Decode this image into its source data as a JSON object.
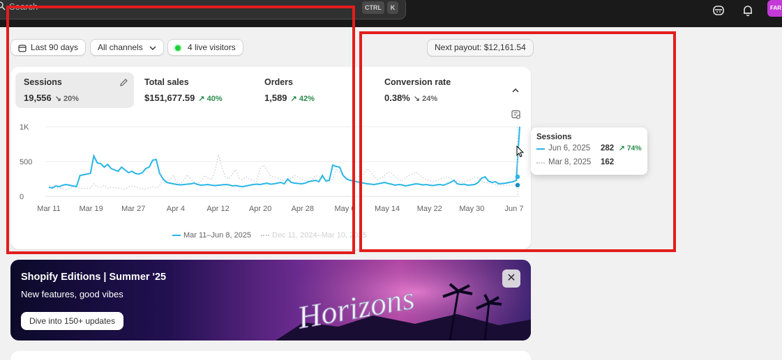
{
  "topbar": {
    "search_placeholder": "Search",
    "shortcut_ctrl": "CTRL",
    "shortcut_k": "K",
    "avatar_initials": "FAR"
  },
  "filters": {
    "date_range": "Last 90 days",
    "channels": "All channels",
    "live_visitors": "4 live visitors",
    "next_payout": "Next payout: $12,161.54"
  },
  "metrics": [
    {
      "label": "Sessions",
      "value": "19,556",
      "change": "20%",
      "direction": "down"
    },
    {
      "label": "Total sales",
      "value": "$151,677.59",
      "change": "40%",
      "direction": "up"
    },
    {
      "label": "Orders",
      "value": "1,589",
      "change": "42%",
      "direction": "up"
    },
    {
      "label": "Conversion rate",
      "value": "0.38%",
      "change": "24%",
      "direction": "down"
    }
  ],
  "chart_data": {
    "type": "line",
    "y_ticks": [
      "1K",
      "500",
      "0"
    ],
    "ylim": [
      0,
      1000
    ],
    "x_ticks": [
      "Mar 11",
      "Mar 19",
      "Mar 27",
      "Apr 4",
      "Apr 12",
      "Apr 20",
      "Apr 28",
      "May 6",
      "May 14",
      "May 22",
      "May 30",
      "Jun 7"
    ],
    "series": [
      {
        "name": "Mar 11–Jun 8, 2025",
        "color": "#29b6e6",
        "style": "solid",
        "values": [
          130,
          120,
          150,
          140,
          160,
          170,
          160,
          150,
          140,
          300,
          310,
          320,
          330,
          580,
          480,
          470,
          420,
          460,
          400,
          380,
          360,
          420,
          380,
          340,
          360,
          330,
          320,
          340,
          400,
          420,
          520,
          530,
          330,
          250,
          200,
          190,
          180,
          170,
          165,
          170,
          175,
          180,
          190,
          170,
          160,
          165,
          170,
          160,
          155,
          160,
          165,
          170,
          165,
          150,
          155,
          145,
          140,
          150,
          160,
          170,
          175,
          170,
          180,
          190,
          175,
          180,
          190,
          200,
          180,
          250,
          200,
          190,
          185,
          180,
          190,
          210,
          220,
          230,
          210,
          300,
          220,
          230,
          450,
          430,
          420,
          300,
          250,
          230,
          220,
          210,
          200,
          190,
          180,
          175,
          170,
          180,
          190,
          200,
          185,
          175,
          160,
          170,
          165,
          150,
          160,
          170,
          180,
          175,
          165,
          170,
          160,
          155,
          165,
          170,
          160,
          180,
          200,
          230,
          180,
          170,
          175,
          160,
          165,
          170,
          200,
          260,
          280,
          220,
          200,
          210,
          180,
          185,
          190,
          200,
          210,
          230,
          1000
        ]
      },
      {
        "name": "Dec 11, 2024–Mar 10, 2025",
        "color": "#c8ccd2",
        "style": "dotted",
        "values": [
          150,
          140,
          130,
          120,
          110,
          100,
          120,
          140,
          130,
          120,
          110,
          115,
          120,
          180,
          140,
          130,
          160,
          120,
          130,
          125,
          120,
          110,
          100,
          130,
          150,
          140,
          120,
          110,
          100,
          130,
          140,
          120,
          150,
          250,
          220,
          240,
          300,
          200,
          180,
          230,
          310,
          250,
          200,
          180,
          220,
          300,
          260,
          240,
          360,
          600,
          420,
          280,
          250,
          320,
          380,
          260,
          240,
          280,
          250,
          230,
          210,
          400,
          450,
          380,
          300,
          280,
          260,
          240,
          230,
          220,
          260,
          300,
          280,
          250,
          230,
          220,
          240,
          300,
          280,
          260,
          240,
          220,
          250,
          400,
          350,
          300,
          260,
          240,
          260,
          280,
          300,
          320,
          400,
          350,
          280,
          240,
          260,
          300,
          350,
          330,
          280,
          240,
          220,
          260,
          300,
          320,
          350,
          310,
          270,
          240,
          220,
          210,
          230,
          250,
          260,
          280,
          260,
          240,
          220,
          200,
          210,
          230,
          240,
          280,
          260,
          220,
          200,
          190,
          180,
          170,
          160,
          162,
          160,
          160,
          162,
          162,
          162
        ]
      }
    ]
  },
  "legend": {
    "current": "Mar 11–Jun 8, 2025",
    "previous": "Dec 11, 2024–Mar 10, 2025"
  },
  "tooltip": {
    "title": "Sessions",
    "rows": [
      {
        "date": "Jun 6, 2025",
        "value": "282",
        "change": "74%"
      },
      {
        "date": "Mar 8, 2025",
        "value": "162"
      }
    ]
  },
  "banner": {
    "title": "Shopify Editions | Summer '25",
    "subtitle": "New features, good vibes",
    "button": "Dive into 150+ updates",
    "close": "✕",
    "art_text": "Horizons"
  }
}
